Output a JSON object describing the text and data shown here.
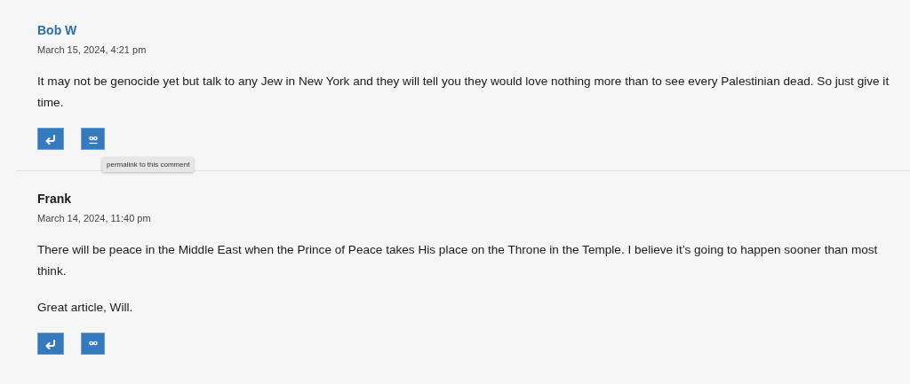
{
  "comments": [
    {
      "author": "Bob W",
      "author_linked": true,
      "date": "March 15, 2024, 4:21 pm",
      "paragraphs": [
        "It may not be genocide yet but talk to any Jew in New York and they will tell you they would love nothing more than to see every Palestinian dead. So just give it time."
      ],
      "permalink_hovered": true,
      "tooltip": "permalink to this comment"
    },
    {
      "author": "Frank",
      "author_linked": false,
      "date": "March 14, 2024, 11:40 pm",
      "paragraphs": [
        "There will be peace in the Middle East when the Prince of Peace takes His place on the Throne in the Temple. I believe it’s going to happen sooner than most think.",
        "Great article, Will."
      ],
      "permalink_hovered": false
    }
  ]
}
